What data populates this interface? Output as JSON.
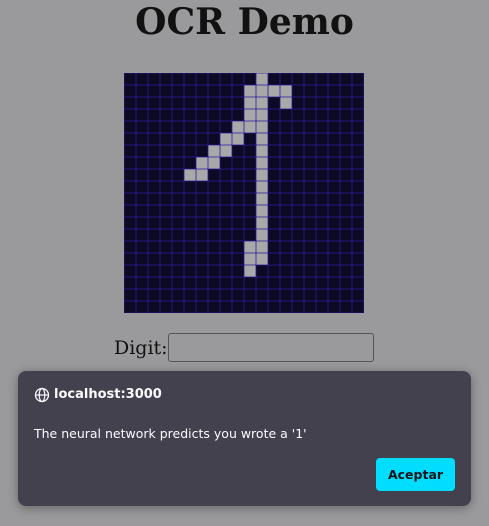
{
  "page": {
    "title": "OCR Demo"
  },
  "canvas": {
    "cols": 20,
    "rows": 20,
    "background_color": "#0c0a22",
    "grid_line_color": "#2a1aa0",
    "pixel_color": "#a8a8a8",
    "filled_cells": [
      [
        11,
        0
      ],
      [
        10,
        1
      ],
      [
        11,
        1
      ],
      [
        12,
        1
      ],
      [
        13,
        1
      ],
      [
        10,
        2
      ],
      [
        11,
        2
      ],
      [
        13,
        2
      ],
      [
        10,
        3
      ],
      [
        11,
        3
      ],
      [
        9,
        4
      ],
      [
        10,
        4
      ],
      [
        11,
        4
      ],
      [
        8,
        5
      ],
      [
        9,
        5
      ],
      [
        11,
        5
      ],
      [
        7,
        6
      ],
      [
        8,
        6
      ],
      [
        11,
        6
      ],
      [
        6,
        7
      ],
      [
        7,
        7
      ],
      [
        11,
        7
      ],
      [
        5,
        8
      ],
      [
        6,
        8
      ],
      [
        11,
        8
      ],
      [
        11,
        9
      ],
      [
        11,
        10
      ],
      [
        11,
        11
      ],
      [
        11,
        12
      ],
      [
        11,
        13
      ],
      [
        11,
        14
      ],
      [
        10,
        14
      ],
      [
        10,
        15
      ],
      [
        11,
        15
      ],
      [
        10,
        16
      ]
    ]
  },
  "digit": {
    "label": "Digit:",
    "value": "",
    "placeholder": ""
  },
  "dialog": {
    "origin": "localhost:3000",
    "icon": "globe-icon",
    "message": "The neural network predicts you wrote a '1'",
    "accept_label": "Aceptar",
    "accent_color": "#00ddff"
  }
}
